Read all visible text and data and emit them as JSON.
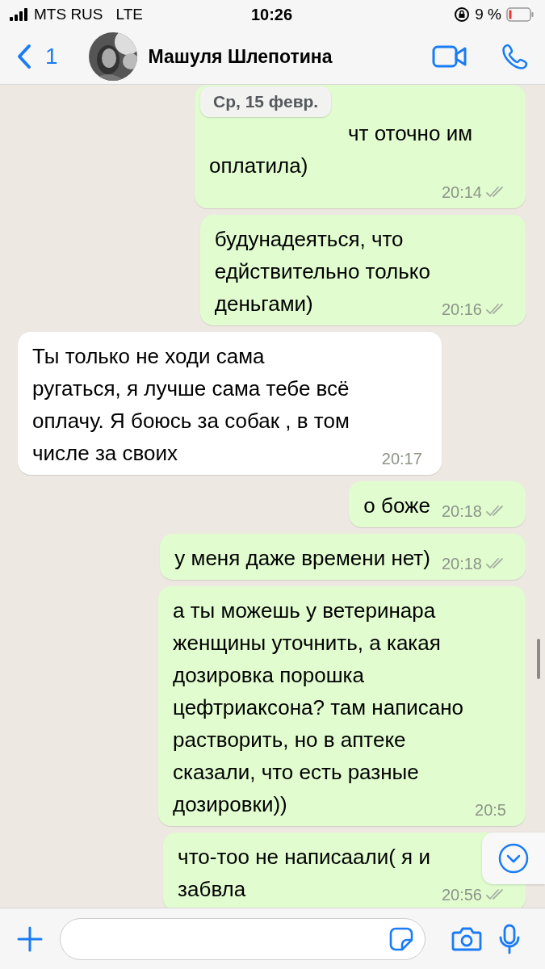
{
  "status_bar": {
    "carrier": "MTS RUS",
    "network": "LTE",
    "time": "10:26",
    "battery": "9 %"
  },
  "header": {
    "back_count": "1",
    "contact_name": "Машуля Шлепотина"
  },
  "date_chip": "Ср, 15 февр.",
  "messages": [
    {
      "outgoing": true,
      "text": "чт оточно им\nоплатила)",
      "time": "20:14",
      "read": false
    },
    {
      "outgoing": true,
      "text": "будунадеяться, что\nедйствительно только\nденьгами)",
      "time": "20:16",
      "read": false
    },
    {
      "outgoing": false,
      "text": "Ты только не ходи сама\nругаться, я лучше сама тебе всё\nоплачу. Я боюсь за собак , в том\nчисле за своих",
      "time": "20:17"
    },
    {
      "outgoing": true,
      "text": "о боже",
      "time": "20:18",
      "read": false
    },
    {
      "outgoing": true,
      "text": "у меня даже времени нет)",
      "time": "20:18",
      "read": false
    },
    {
      "outgoing": true,
      "text": "а ты можешь у ветеринара\nженщины уточнить, а какая\nдозировка порошка\nцефтриаксона? там написано\nрастворить, но в аптеке\nсказали, что есть разные\nдозировки))",
      "time": "20:5"
    },
    {
      "outgoing": true,
      "text": "что-тоо не написаали(  я и\nзабвла",
      "time": "20:56",
      "read": false
    }
  ]
}
